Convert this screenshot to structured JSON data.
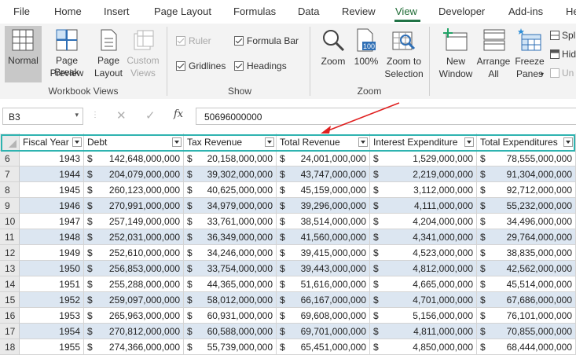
{
  "menu": {
    "tabs": [
      "File",
      "Home",
      "Insert",
      "Page Layout",
      "Formulas",
      "Data",
      "Review",
      "View",
      "Developer",
      "Add-ins",
      "He"
    ],
    "active": "View"
  },
  "ribbon": {
    "workbook_views": {
      "label": "Workbook Views",
      "normal": "Normal",
      "page_break_1": "Page Break",
      "page_break_2": "Preview",
      "page_layout_1": "Page",
      "page_layout_2": "Layout",
      "custom_1": "Custom",
      "custom_2": "Views"
    },
    "show": {
      "label": "Show",
      "ruler": "Ruler",
      "gridlines": "Gridlines",
      "formula_bar": "Formula Bar",
      "headings": "Headings"
    },
    "zoom": {
      "label": "Zoom",
      "zoom": "Zoom",
      "hundred": "100%",
      "hundred_icon": "100",
      "selection_1": "Zoom to",
      "selection_2": "Selection"
    },
    "window": {
      "new_1": "New",
      "new_2": "Window",
      "arrange_1": "Arrange",
      "arrange_2": "All",
      "freeze_1": "Freeze",
      "freeze_2": "Panes",
      "split": "Spl",
      "hide": "Hid",
      "unhide": "Un"
    }
  },
  "formula_bar": {
    "name_box": "B3",
    "fx": "fx",
    "value": "50696000000"
  },
  "table": {
    "headers": [
      "Fiscal Year",
      "Debt",
      "Tax Revenue",
      "Total Revenue",
      "Interest Expenditure",
      "Total Expenditures"
    ],
    "rows": [
      {
        "num": "6",
        "year": "1943",
        "debt": "142,648,000,000",
        "tax": "20,158,000,000",
        "rev": "24,001,000,000",
        "int": "1,529,000,000",
        "exp": "78,555,000,000"
      },
      {
        "num": "7",
        "year": "1944",
        "debt": "204,079,000,000",
        "tax": "39,302,000,000",
        "rev": "43,747,000,000",
        "int": "2,219,000,000",
        "exp": "91,304,000,000"
      },
      {
        "num": "8",
        "year": "1945",
        "debt": "260,123,000,000",
        "tax": "40,625,000,000",
        "rev": "45,159,000,000",
        "int": "3,112,000,000",
        "exp": "92,712,000,000"
      },
      {
        "num": "9",
        "year": "1946",
        "debt": "270,991,000,000",
        "tax": "34,979,000,000",
        "rev": "39,296,000,000",
        "int": "4,111,000,000",
        "exp": "55,232,000,000"
      },
      {
        "num": "10",
        "year": "1947",
        "debt": "257,149,000,000",
        "tax": "33,761,000,000",
        "rev": "38,514,000,000",
        "int": "4,204,000,000",
        "exp": "34,496,000,000"
      },
      {
        "num": "11",
        "year": "1948",
        "debt": "252,031,000,000",
        "tax": "36,349,000,000",
        "rev": "41,560,000,000",
        "int": "4,341,000,000",
        "exp": "29,764,000,000"
      },
      {
        "num": "12",
        "year": "1949",
        "debt": "252,610,000,000",
        "tax": "34,246,000,000",
        "rev": "39,415,000,000",
        "int": "4,523,000,000",
        "exp": "38,835,000,000"
      },
      {
        "num": "13",
        "year": "1950",
        "debt": "256,853,000,000",
        "tax": "33,754,000,000",
        "rev": "39,443,000,000",
        "int": "4,812,000,000",
        "exp": "42,562,000,000"
      },
      {
        "num": "14",
        "year": "1951",
        "debt": "255,288,000,000",
        "tax": "44,365,000,000",
        "rev": "51,616,000,000",
        "int": "4,665,000,000",
        "exp": "45,514,000,000"
      },
      {
        "num": "15",
        "year": "1952",
        "debt": "259,097,000,000",
        "tax": "58,012,000,000",
        "rev": "66,167,000,000",
        "int": "4,701,000,000",
        "exp": "67,686,000,000"
      },
      {
        "num": "16",
        "year": "1953",
        "debt": "265,963,000,000",
        "tax": "60,931,000,000",
        "rev": "69,608,000,000",
        "int": "5,156,000,000",
        "exp": "76,101,000,000"
      },
      {
        "num": "17",
        "year": "1954",
        "debt": "270,812,000,000",
        "tax": "60,588,000,000",
        "rev": "69,701,000,000",
        "int": "4,811,000,000",
        "exp": "70,855,000,000"
      },
      {
        "num": "18",
        "year": "1955",
        "debt": "274,366,000,000",
        "tax": "55,739,000,000",
        "rev": "65,451,000,000",
        "int": "4,850,000,000",
        "exp": "68,444,000,000"
      }
    ]
  },
  "colors": {
    "band": "#dce6f1",
    "accent": "#217346",
    "freeze_border": "#2fb3b0",
    "arrow": "#e02020"
  }
}
